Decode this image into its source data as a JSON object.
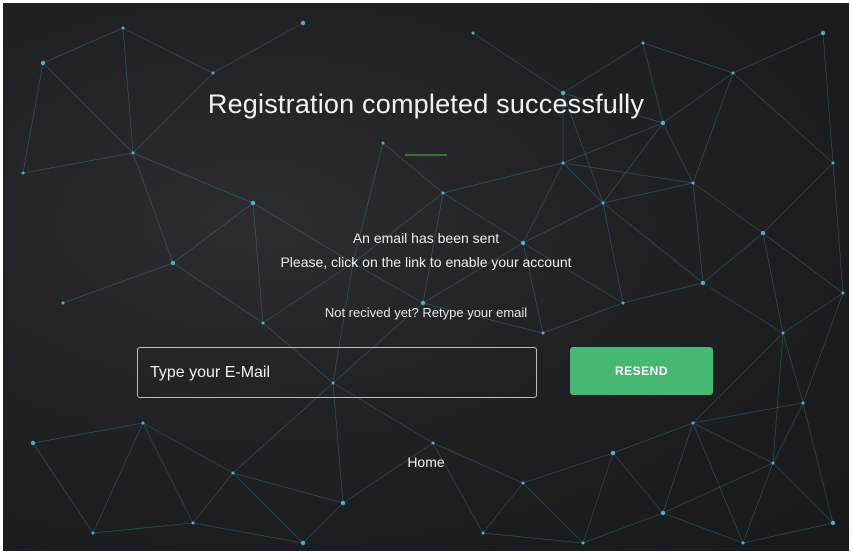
{
  "page": {
    "title": "Registration completed successfully",
    "message_line_1": "An email has been sent",
    "message_line_2": "Please, click on the link to enable your account",
    "resend_hint": "Not recived yet? Retype your email",
    "email_placeholder": "Type your E-Mail",
    "email_value": "",
    "resend_label": "RESEND",
    "home_label": "Home"
  },
  "colors": {
    "background": "#1f2124",
    "network_lines": "#4fa3c4",
    "accent_divider": "#3d6e3f",
    "button": "#46b874",
    "text": "#f2f2f2"
  }
}
